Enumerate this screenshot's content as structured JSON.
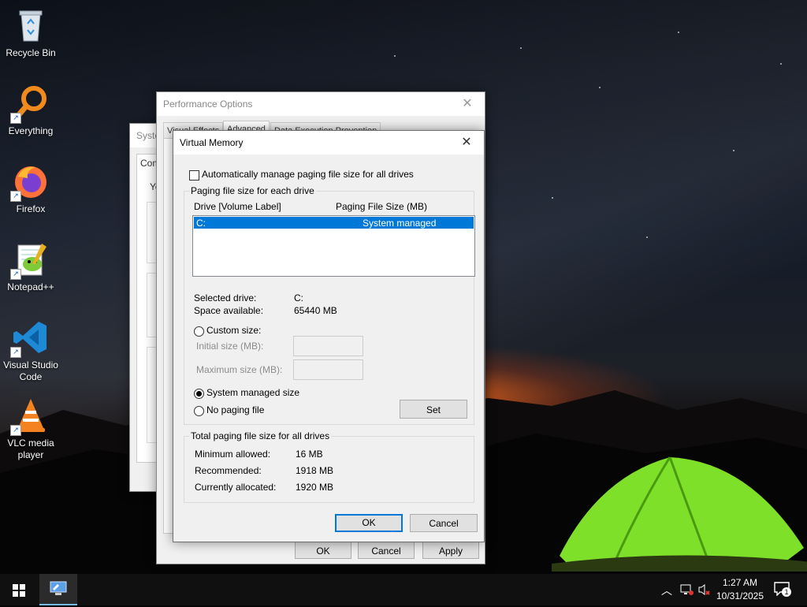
{
  "desktop": {
    "icons": [
      {
        "label": "Recycle Bin",
        "icon": "recycle-bin-icon"
      },
      {
        "label": "Everything",
        "icon": "everything-search-icon"
      },
      {
        "label": "Firefox",
        "icon": "firefox-icon"
      },
      {
        "label": "Notepad++",
        "icon": "notepad-plus-plus-icon"
      },
      {
        "label": "Visual Studio Code",
        "icon": "vscode-icon"
      },
      {
        "label": "VLC media player",
        "icon": "vlc-icon"
      }
    ]
  },
  "system_props": {
    "title_fragment": "Syste",
    "tab_fragment": "Com",
    "text_fragment": "Yo"
  },
  "perf": {
    "title": "Performance Options",
    "tabs": [
      "Visual Effects",
      "Advanced",
      "Data Execution Prevention"
    ],
    "ok": "OK",
    "cancel": "Cancel",
    "apply": "Apply"
  },
  "vm": {
    "title": "Virtual Memory",
    "auto_manage_label": "Automatically manage paging file size for all drives",
    "auto_manage_checked": false,
    "paging_group_title": "Paging file size for each drive",
    "col_drive": "Drive  [Volume Label]",
    "col_size": "Paging File Size (MB)",
    "drives": [
      {
        "drive": "C:",
        "size": "System managed"
      }
    ],
    "selected_drive_label": "Selected drive:",
    "selected_drive_value": "C:",
    "space_available_label": "Space available:",
    "space_available_value": "65440 MB",
    "custom_size_label": "Custom size:",
    "initial_size_label": "Initial size (MB):",
    "maximum_size_label": "Maximum size (MB):",
    "system_managed_label": "System managed size",
    "no_paging_label": "No paging file",
    "selected_option": "System managed size",
    "set_label": "Set",
    "total_group_title": "Total paging file size for all drives",
    "min_allowed_label": "Minimum allowed:",
    "min_allowed_value": "16 MB",
    "recommended_label": "Recommended:",
    "recommended_value": "1918 MB",
    "currently_allocated_label": "Currently allocated:",
    "currently_allocated_value": "1920 MB",
    "ok": "OK",
    "cancel": "Cancel"
  },
  "taskbar": {
    "time": "1:27 AM",
    "date": "10/31/2025",
    "notification_count": "1"
  },
  "colors": {
    "accent": "#0078d7",
    "selection": "#0078d7"
  }
}
